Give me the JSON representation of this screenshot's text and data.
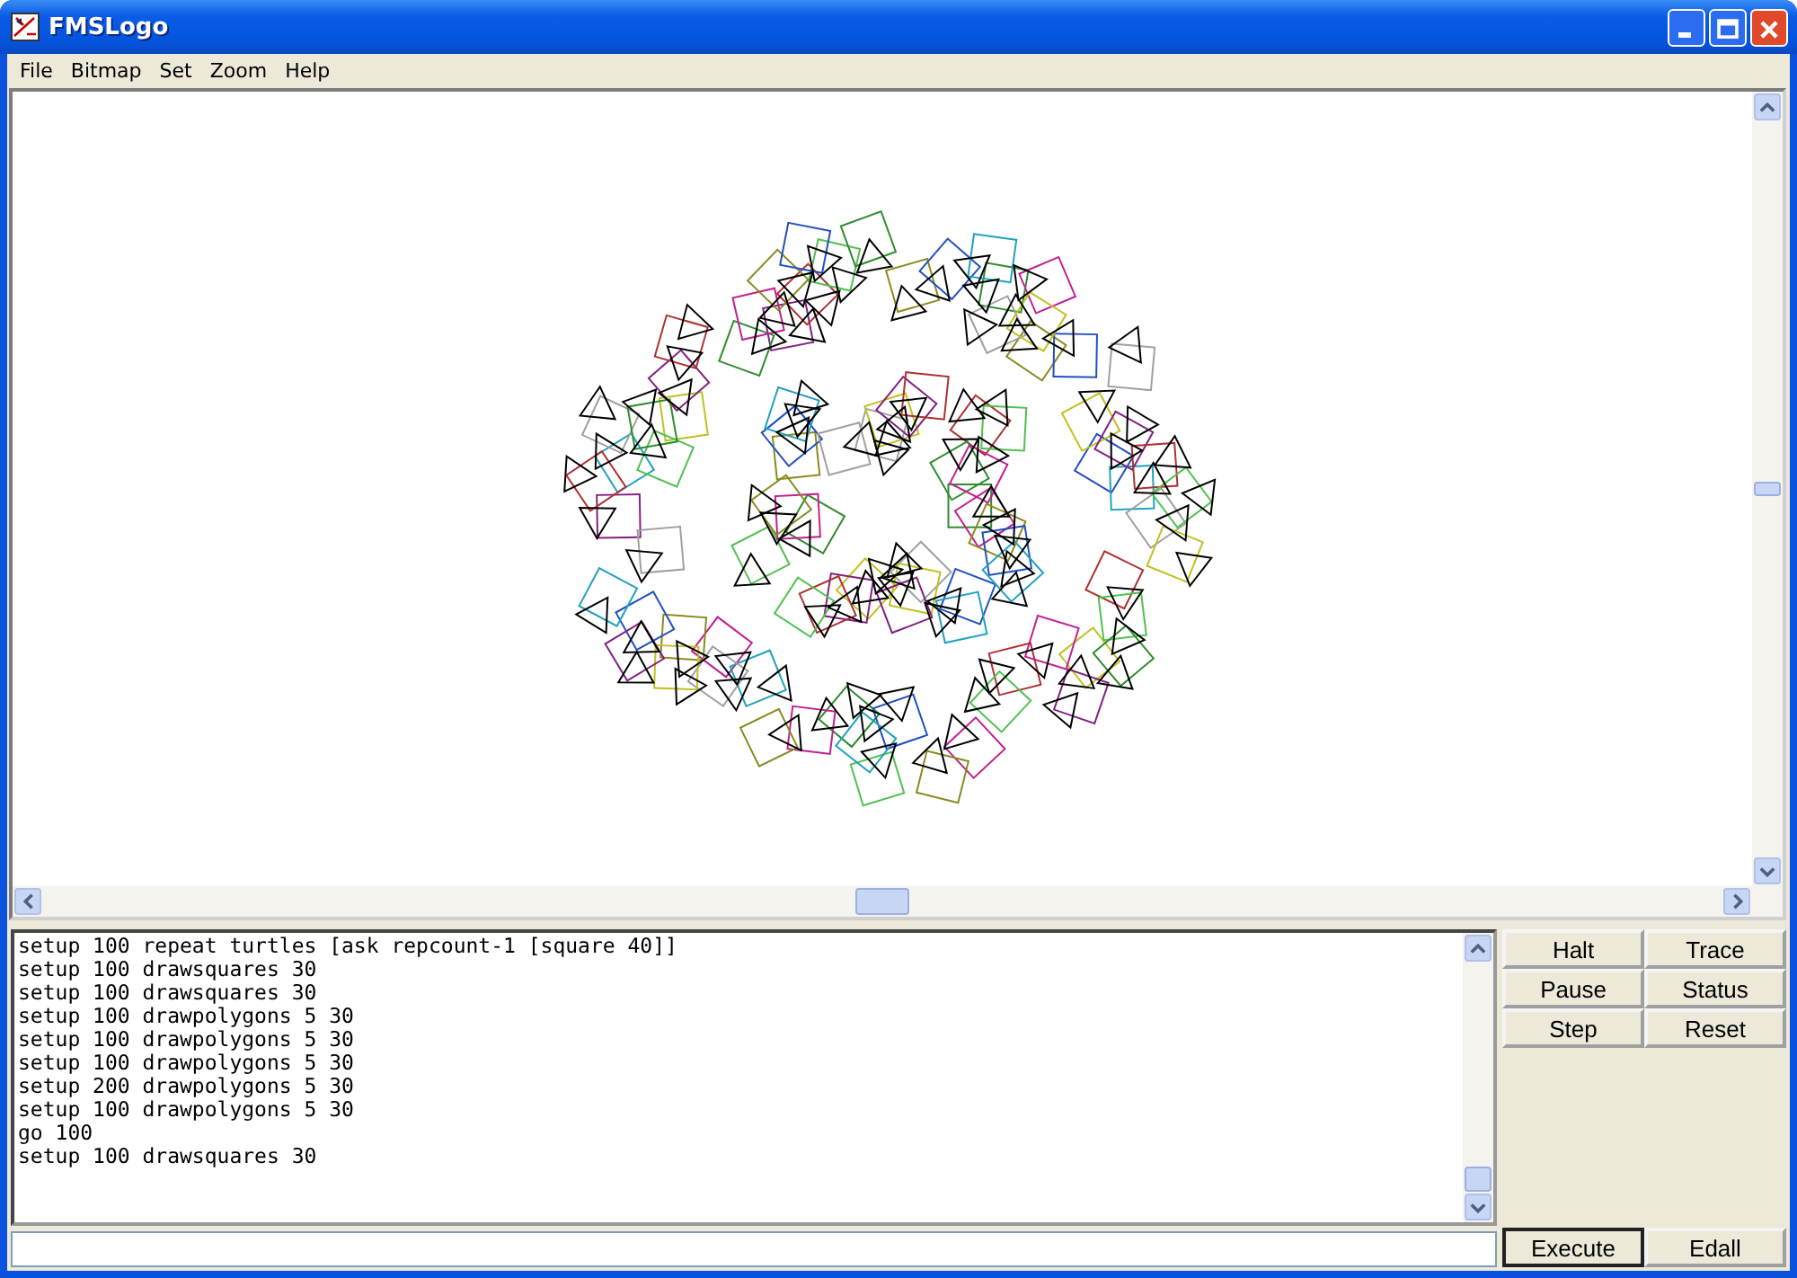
{
  "window": {
    "title": "FMSLogo"
  },
  "menu": [
    "File",
    "Bitmap",
    "Set",
    "Zoom",
    "Help"
  ],
  "history": [
    "setup 100 repeat turtles [ask repcount-1 [square 40]]",
    "setup 100 drawsquares 30",
    "setup 100 drawsquares 30",
    "setup 100 drawpolygons 5 30",
    "setup 100 drawpolygons 5 30",
    "setup 100 drawpolygons 5 30",
    "setup 200 drawpolygons 5 30",
    "setup 100 drawpolygons 5 30",
    "go 100",
    "setup 100 drawsquares 30"
  ],
  "buttons": [
    "Halt",
    "Trace",
    "Pause",
    "Status",
    "Step",
    "Reset"
  ],
  "bottom_buttons": [
    {
      "label": "Execute",
      "default": true
    },
    {
      "label": "Edall",
      "default": false
    }
  ]
}
